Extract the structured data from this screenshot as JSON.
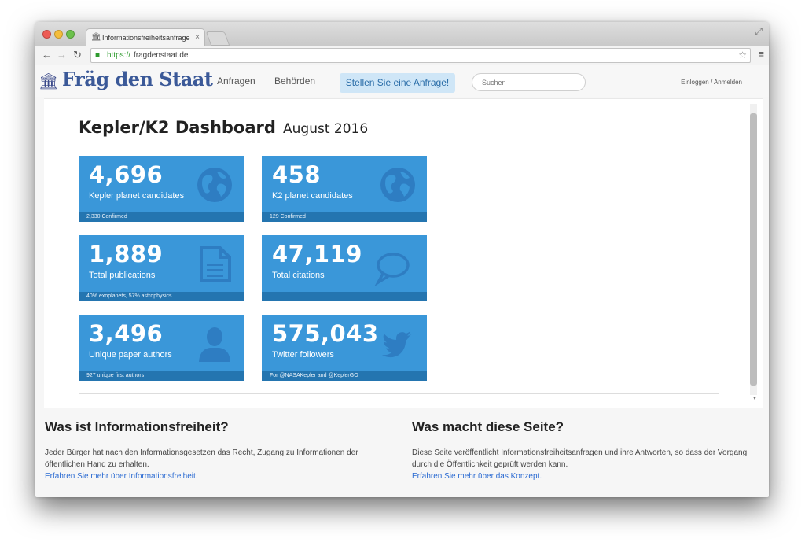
{
  "browser": {
    "tab_title": "Informationsfreiheitsanfrage",
    "tab_close": "×",
    "url_scheme": "https://",
    "url_host": "fragdenstaat.de"
  },
  "site": {
    "logo": "Fräg den Staat",
    "nav": [
      "Anfragen",
      "Behörden"
    ],
    "cta": "Stellen Sie eine Anfrage!",
    "search_placeholder": "Suchen",
    "login": "Einloggen / Anmelden"
  },
  "dashboard": {
    "title": "Kepler/K2 Dashboard",
    "subtitle": "August 2016",
    "cards": [
      {
        "value": "4,696",
        "label": "Kepler planet candidates",
        "foot": "2,330 Confirmed",
        "icon": "globe-icon"
      },
      {
        "value": "458",
        "label": "K2 planet candidates",
        "foot": "129 Confirmed",
        "icon": "globe-icon"
      },
      {
        "value": "1,889",
        "label": "Total publications",
        "foot": "40% exoplanets, 57% astrophysics",
        "icon": "document-icon"
      },
      {
        "value": "47,119",
        "label": "Total citations",
        "foot": "",
        "icon": "speech-bubble-icon"
      },
      {
        "value": "3,496",
        "label": "Unique paper authors",
        "foot": "927 unique first authors",
        "icon": "user-icon"
      },
      {
        "value": "575,043",
        "label": "Twitter followers",
        "foot": "For @NASAKepler and @KeplerGO",
        "icon": "twitter-bird-icon"
      }
    ],
    "card_color": "#3a97d9"
  },
  "info": {
    "left": {
      "heading": "Was ist Informationsfreiheit?",
      "text": "Jeder Bürger hat nach den Informationsgesetzen das Recht, Zugang zu Informationen der öffentlichen Hand zu erhalten.",
      "link": "Erfahren Sie mehr über Informationsfreiheit."
    },
    "right": {
      "heading": "Was macht diese Seite?",
      "text": "Diese Seite veröffentlicht Informationsfreiheitsanfragen und ihre Antworten, so dass der Vorgang durch die Öffentlichkeit geprüft werden kann.",
      "link": "Erfahren Sie mehr über das Konzept."
    }
  }
}
